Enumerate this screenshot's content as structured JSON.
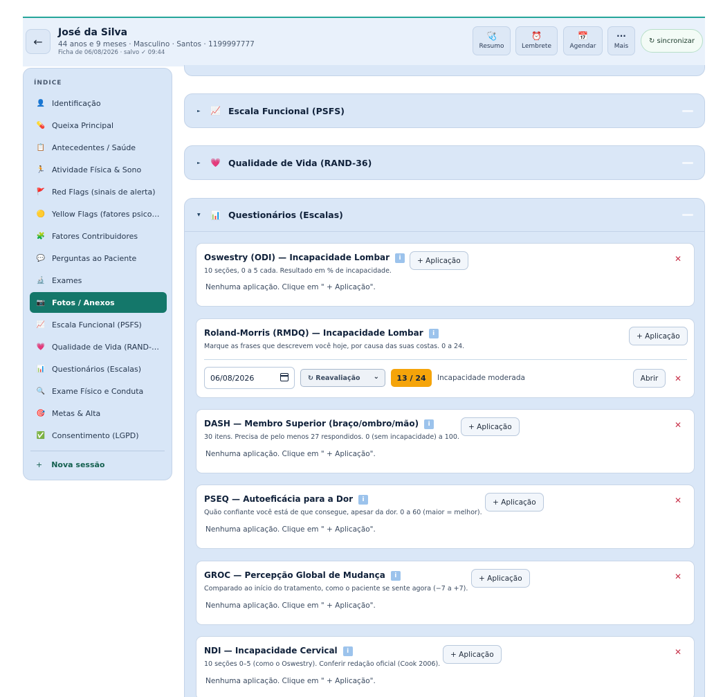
{
  "header": {
    "back_label": "←",
    "patient_name": "José da Silva",
    "patient_meta": "44 anos e 9 meses · Masculino · Santos · 1199997777",
    "patient_saved": "Ficha de 06/08/2026 · salvo ✓ 09:44",
    "buttons": [
      {
        "label": "Resumo",
        "icon": "🩺"
      },
      {
        "label": "Lembrete",
        "icon": "⏰"
      },
      {
        "label": "Agendar",
        "icon": "📅"
      },
      {
        "label": "Mais",
        "icon": "···"
      }
    ],
    "sync_label": "↻ sincronizar"
  },
  "sidebar": {
    "title": "ÍNDICE",
    "items": [
      {
        "label": "Identificação",
        "icon": "👤"
      },
      {
        "label": "Queixa Principal",
        "icon": "💊"
      },
      {
        "label": "Antecedentes / Saúde",
        "icon": "📋"
      },
      {
        "label": "Atividade Física & Sono",
        "icon": "🏃"
      },
      {
        "label": "Red Flags (sinais de alerta)",
        "icon": "🚩"
      },
      {
        "label": "Yellow Flags (fatores psicoss...",
        "icon": "🟡"
      },
      {
        "label": "Fatores Contribuidores",
        "icon": "🧩"
      },
      {
        "label": "Perguntas ao Paciente",
        "icon": "💬"
      },
      {
        "label": "Exames",
        "icon": "🔬"
      },
      {
        "label": "Fotos / Anexos",
        "icon": "📷"
      },
      {
        "label": "Escala Funcional (PSFS)",
        "icon": "📈"
      },
      {
        "label": "Qualidade de Vida (RAND-36)",
        "icon": "💗"
      },
      {
        "label": "Questionários (Escalas)",
        "icon": "📊"
      },
      {
        "label": "Exame Físico e Conduta",
        "icon": "🔍"
      },
      {
        "label": "Metas & Alta",
        "icon": "🎯"
      },
      {
        "label": "Consentimento (LGPD)",
        "icon": "✅"
      }
    ],
    "active_label": "Fotos / Anexos",
    "new_session": {
      "plus": "+",
      "label": "Nova sessão"
    }
  },
  "sections": {
    "psfs": {
      "title": "Escala Funcional (PSFS)",
      "icon": "📈"
    },
    "rand": {
      "title": "Qualidade de Vida (RAND-36)",
      "icon": "💗"
    },
    "questionarios": {
      "title": "Questionários (Escalas)",
      "icon": "📊"
    }
  },
  "questionnaires": [
    {
      "title": "Oswestry (ODI) — Incapacidade Lombar",
      "desc": "10 seções, 0 a 5 cada. Resultado em % de incapacidade.",
      "empty": "Nenhuma aplicação. Clique em \" + Aplicação\".",
      "add_label": "+ Aplicação"
    },
    {
      "title": "Roland-Morris (RMDQ) — Incapacidade Lombar",
      "desc": "Marque as frases que descrevem você hoje, por causa das suas costas. 0 a 24.",
      "add_label": "+ Aplicação",
      "application": {
        "date": "06/08/2026",
        "type": "↻ Reavaliação",
        "score": "13 / 24",
        "score_label": "Incapacidade moderada",
        "open_label": "Abrir"
      }
    },
    {
      "title": "DASH — Membro Superior (braço/ombro/mão)",
      "desc": "30 itens. Precisa de pelo menos 27 respondidos. 0 (sem incapacidade) a 100.",
      "empty": "Nenhuma aplicação. Clique em \" + Aplicação\".",
      "add_label": "+ Aplicação"
    },
    {
      "title": "PSEQ — Autoeficácia para a Dor",
      "desc": "Quão confiante você está de que consegue, apesar da dor. 0 a 60 (maior = melhor).",
      "empty": "Nenhuma aplicação. Clique em \" + Aplicação\".",
      "add_label": "+ Aplicação"
    },
    {
      "title": "GROC — Percepção Global de Mudança",
      "desc": "Comparado ao início do tratamento, como o paciente se sente agora (−7 a +7).",
      "empty": "Nenhuma aplicação. Clique em \" + Aplicação\".",
      "add_label": "+ Aplicação"
    },
    {
      "title": "NDI — Incapacidade Cervical",
      "desc": "10 seções 0–5 (como o Oswestry). Conferir redação oficial (Cook 2006).",
      "empty": "Nenhuma aplicação. Clique em \" + Aplicação\".",
      "add_label": "+ Aplicação"
    }
  ],
  "icons": {
    "info": "i",
    "remove": "✕",
    "collapsed_arrow": "►",
    "expanded_arrow": "▼",
    "select_chevron": "⌄"
  }
}
